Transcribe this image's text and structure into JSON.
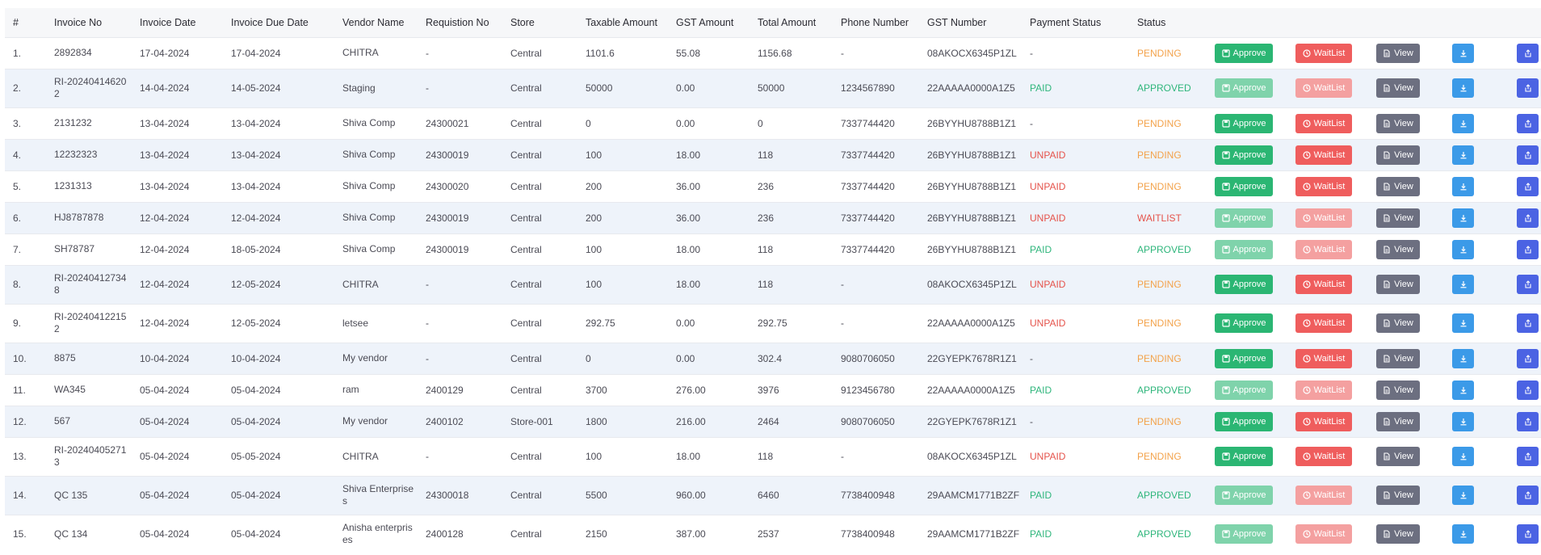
{
  "columns": [
    "#",
    "Invoice No",
    "Invoice Date",
    "Invoice Due Date",
    "Vendor Name",
    "Requistion No",
    "Store",
    "Taxable Amount",
    "GST Amount",
    "Total Amount",
    "Phone Number",
    "GST Number",
    "Payment Status",
    "Status"
  ],
  "buttons": {
    "approve": "Approve",
    "waitlist": "WaitList",
    "view": "View"
  },
  "icons": {
    "approve": "save-icon",
    "waitlist": "clock-icon",
    "view": "document-icon",
    "download": "download-icon",
    "upload": "upload-icon"
  },
  "colors": {
    "approve": "#2bb673",
    "waitlist": "#ef5d5d",
    "view": "#6c6f80",
    "download": "#3b9ae8",
    "upload": "#4b63e3",
    "paid": "#2fb67c",
    "unpaid": "#e5534b",
    "pending": "#f3a24a"
  },
  "rows": [
    {
      "num": "1.",
      "invoice_no": "2892834",
      "invoice_date": "17-04-2024",
      "due_date": "17-04-2024",
      "vendor": "CHITRA",
      "requisition": "-",
      "store": "Central",
      "taxable": "1101.6",
      "gst": "55.08",
      "total": "1156.68",
      "phone": "-",
      "gst_number": "08AKOCX6345P1ZL",
      "payment_status": "-",
      "status": "PENDING",
      "actions_enabled": true
    },
    {
      "num": "2.",
      "invoice_no": "RI-202404146202",
      "invoice_date": "14-04-2024",
      "due_date": "14-05-2024",
      "vendor": "Staging",
      "requisition": "-",
      "store": "Central",
      "taxable": "50000",
      "gst": "0.00",
      "total": "50000",
      "phone": "1234567890",
      "gst_number": "22AAAAA0000A1Z5",
      "payment_status": "PAID",
      "status": "APPROVED",
      "actions_enabled": false
    },
    {
      "num": "3.",
      "invoice_no": "2131232",
      "invoice_date": "13-04-2024",
      "due_date": "13-04-2024",
      "vendor": "Shiva Comp",
      "requisition": "24300021",
      "store": "Central",
      "taxable": "0",
      "gst": "0.00",
      "total": "0",
      "phone": "7337744420",
      "gst_number": "26BYYHU8788B1Z1",
      "payment_status": "-",
      "status": "PENDING",
      "actions_enabled": true
    },
    {
      "num": "4.",
      "invoice_no": "12232323",
      "invoice_date": "13-04-2024",
      "due_date": "13-04-2024",
      "vendor": "Shiva Comp",
      "requisition": "24300019",
      "store": "Central",
      "taxable": "100",
      "gst": "18.00",
      "total": "118",
      "phone": "7337744420",
      "gst_number": "26BYYHU8788B1Z1",
      "payment_status": "UNPAID",
      "status": "PENDING",
      "actions_enabled": true
    },
    {
      "num": "5.",
      "invoice_no": "1231313",
      "invoice_date": "13-04-2024",
      "due_date": "13-04-2024",
      "vendor": "Shiva Comp",
      "requisition": "24300020",
      "store": "Central",
      "taxable": "200",
      "gst": "36.00",
      "total": "236",
      "phone": "7337744420",
      "gst_number": "26BYYHU8788B1Z1",
      "payment_status": "UNPAID",
      "status": "PENDING",
      "actions_enabled": true
    },
    {
      "num": "6.",
      "invoice_no": "HJ8787878",
      "invoice_date": "12-04-2024",
      "due_date": "12-04-2024",
      "vendor": "Shiva Comp",
      "requisition": "24300019",
      "store": "Central",
      "taxable": "200",
      "gst": "36.00",
      "total": "236",
      "phone": "7337744420",
      "gst_number": "26BYYHU8788B1Z1",
      "payment_status": "UNPAID",
      "status": "WAITLIST",
      "actions_enabled": false
    },
    {
      "num": "7.",
      "invoice_no": "SH78787",
      "invoice_date": "12-04-2024",
      "due_date": "18-05-2024",
      "vendor": "Shiva Comp",
      "requisition": "24300019",
      "store": "Central",
      "taxable": "100",
      "gst": "18.00",
      "total": "118",
      "phone": "7337744420",
      "gst_number": "26BYYHU8788B1Z1",
      "payment_status": "PAID",
      "status": "APPROVED",
      "actions_enabled": false
    },
    {
      "num": "8.",
      "invoice_no": "RI-202404127348",
      "invoice_date": "12-04-2024",
      "due_date": "12-05-2024",
      "vendor": "CHITRA",
      "requisition": "-",
      "store": "Central",
      "taxable": "100",
      "gst": "18.00",
      "total": "118",
      "phone": "-",
      "gst_number": "08AKOCX6345P1ZL",
      "payment_status": "UNPAID",
      "status": "PENDING",
      "actions_enabled": true
    },
    {
      "num": "9.",
      "invoice_no": "RI-202404122152",
      "invoice_date": "12-04-2024",
      "due_date": "12-05-2024",
      "vendor": "letsee",
      "requisition": "-",
      "store": "Central",
      "taxable": "292.75",
      "gst": "0.00",
      "total": "292.75",
      "phone": "-",
      "gst_number": "22AAAAA0000A1Z5",
      "payment_status": "UNPAID",
      "status": "PENDING",
      "actions_enabled": true
    },
    {
      "num": "10.",
      "invoice_no": "8875",
      "invoice_date": "10-04-2024",
      "due_date": "10-04-2024",
      "vendor": "My vendor",
      "requisition": "-",
      "store": "Central",
      "taxable": "0",
      "gst": "0.00",
      "total": "302.4",
      "phone": "9080706050",
      "gst_number": "22GYEPK7678R1Z1",
      "payment_status": "-",
      "status": "PENDING",
      "actions_enabled": true
    },
    {
      "num": "11.",
      "invoice_no": "WA345",
      "invoice_date": "05-04-2024",
      "due_date": "05-04-2024",
      "vendor": "ram",
      "requisition": "2400129",
      "store": "Central",
      "taxable": "3700",
      "gst": "276.00",
      "total": "3976",
      "phone": "9123456780",
      "gst_number": "22AAAAA0000A1Z5",
      "payment_status": "PAID",
      "status": "APPROVED",
      "actions_enabled": false
    },
    {
      "num": "12.",
      "invoice_no": "567",
      "invoice_date": "05-04-2024",
      "due_date": "05-04-2024",
      "vendor": "My vendor",
      "requisition": "2400102",
      "store": "Store-001",
      "taxable": "1800",
      "gst": "216.00",
      "total": "2464",
      "phone": "9080706050",
      "gst_number": "22GYEPK7678R1Z1",
      "payment_status": "-",
      "status": "PENDING",
      "actions_enabled": true
    },
    {
      "num": "13.",
      "invoice_no": "RI-202404052713",
      "invoice_date": "05-04-2024",
      "due_date": "05-05-2024",
      "vendor": "CHITRA",
      "requisition": "-",
      "store": "Central",
      "taxable": "100",
      "gst": "18.00",
      "total": "118",
      "phone": "-",
      "gst_number": "08AKOCX6345P1ZL",
      "payment_status": "UNPAID",
      "status": "PENDING",
      "actions_enabled": true
    },
    {
      "num": "14.",
      "invoice_no": "QC 135",
      "invoice_date": "05-04-2024",
      "due_date": "05-04-2024",
      "vendor": "Shiva Enterprises",
      "requisition": "24300018",
      "store": "Central",
      "taxable": "5500",
      "gst": "960.00",
      "total": "6460",
      "phone": "7738400948",
      "gst_number": "29AAMCM1771B2ZF",
      "payment_status": "PAID",
      "status": "APPROVED",
      "actions_enabled": false
    },
    {
      "num": "15.",
      "invoice_no": "QC 134",
      "invoice_date": "05-04-2024",
      "due_date": "05-04-2024",
      "vendor": "Anisha enterprises",
      "requisition": "2400128",
      "store": "Central",
      "taxable": "2150",
      "gst": "387.00",
      "total": "2537",
      "phone": "7738400948",
      "gst_number": "29AAMCM1771B2ZF",
      "payment_status": "PAID",
      "status": "APPROVED",
      "actions_enabled": false
    }
  ]
}
